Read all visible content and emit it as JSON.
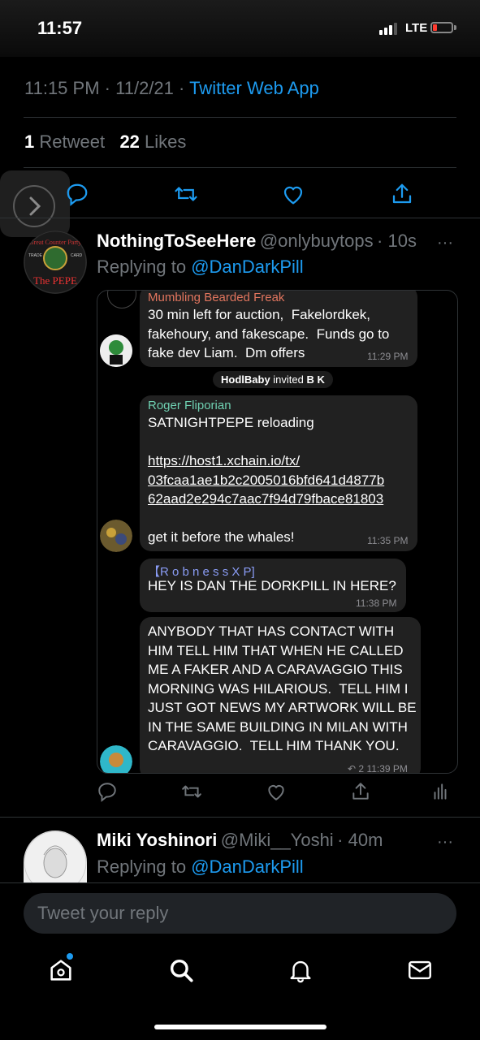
{
  "status_bar": {
    "time": "11:57",
    "network": "LTE",
    "battery_level": 0.15,
    "battery_color": "#ff3b30"
  },
  "tweet": {
    "time": "11:15 PM",
    "date": "11/2/21",
    "separator": "·",
    "source": "Twitter Web App",
    "retweet_count": "1",
    "retweet_label": "Retweet",
    "like_count": "22",
    "like_label": "Likes"
  },
  "reply1": {
    "name": "NothingToSeeHere",
    "handle": "@onlybuytops",
    "age": "· 10s",
    "replying_label": "Replying to",
    "replying_handle": "@DanDarkPill",
    "avatar_text": "The PEPE",
    "avatar_ring_text": "Great Counter Party",
    "avatar_trade": "TRADE",
    "avatar_card": "CARD"
  },
  "telegram": {
    "messages": [
      {
        "sender": "Mumbling Bearded Freak",
        "sender_color": "#e1755e",
        "text": "30 min left for auction,  Fakelordkek, fakehoury, and fakescape.  Funds go to fake dev Liam.  Dm offers",
        "time": "11:29 PM"
      },
      {
        "system": "HodlBaby invited B K",
        "system_name": "HodlBaby",
        "system_action": "invited",
        "system_target": "B K"
      },
      {
        "sender": "Roger Fliporian",
        "sender_color": "#6fd1b2",
        "text_line1": "SATNIGHTPEPE reloading",
        "link": "https://host1.xchain.io/tx/\n03fcaa1ae1b2c2005016bfd641d4877b\n62aad2e294c7aac7f94d79fbace81803",
        "text_line2": "get it before the whales!",
        "time": "11:35 PM"
      },
      {
        "sender": "【R o b n e s s X P]",
        "sender_color": "#8a9cf5",
        "text": "HEY IS DAN THE DORKPILL IN HERE?",
        "time": "11:38 PM"
      },
      {
        "text": "ANYBODY THAT HAS CONTACT WITH HIM TELL HIM THAT WHEN HE CALLED ME A FAKER AND A CARAVAGGIO THIS MORNING WAS HILARIOUS.  TELL HIM I JUST GOT NEWS MY ARTWORK WILL BE IN THE SAME BUILDING IN MILAN WITH CARAVAGGIO.  TELL HIM THANK YOU.",
        "forward_count": "2",
        "time": "11:39 PM"
      }
    ]
  },
  "reply2": {
    "name": "Miki Yoshinori",
    "handle": "@Miki__Yoshi",
    "age": "· 40m",
    "replying_label": "Replying to",
    "replying_handle": "@DanDarkPill"
  },
  "composer": {
    "placeholder": "Tweet your reply"
  },
  "icons": {
    "actions": [
      "reply-icon",
      "retweet-icon",
      "like-icon",
      "share-icon",
      "analytics-icon"
    ],
    "tabs": [
      "home-icon",
      "search-icon",
      "notifications-icon",
      "messages-icon"
    ],
    "accent": "#1d9bf0"
  }
}
